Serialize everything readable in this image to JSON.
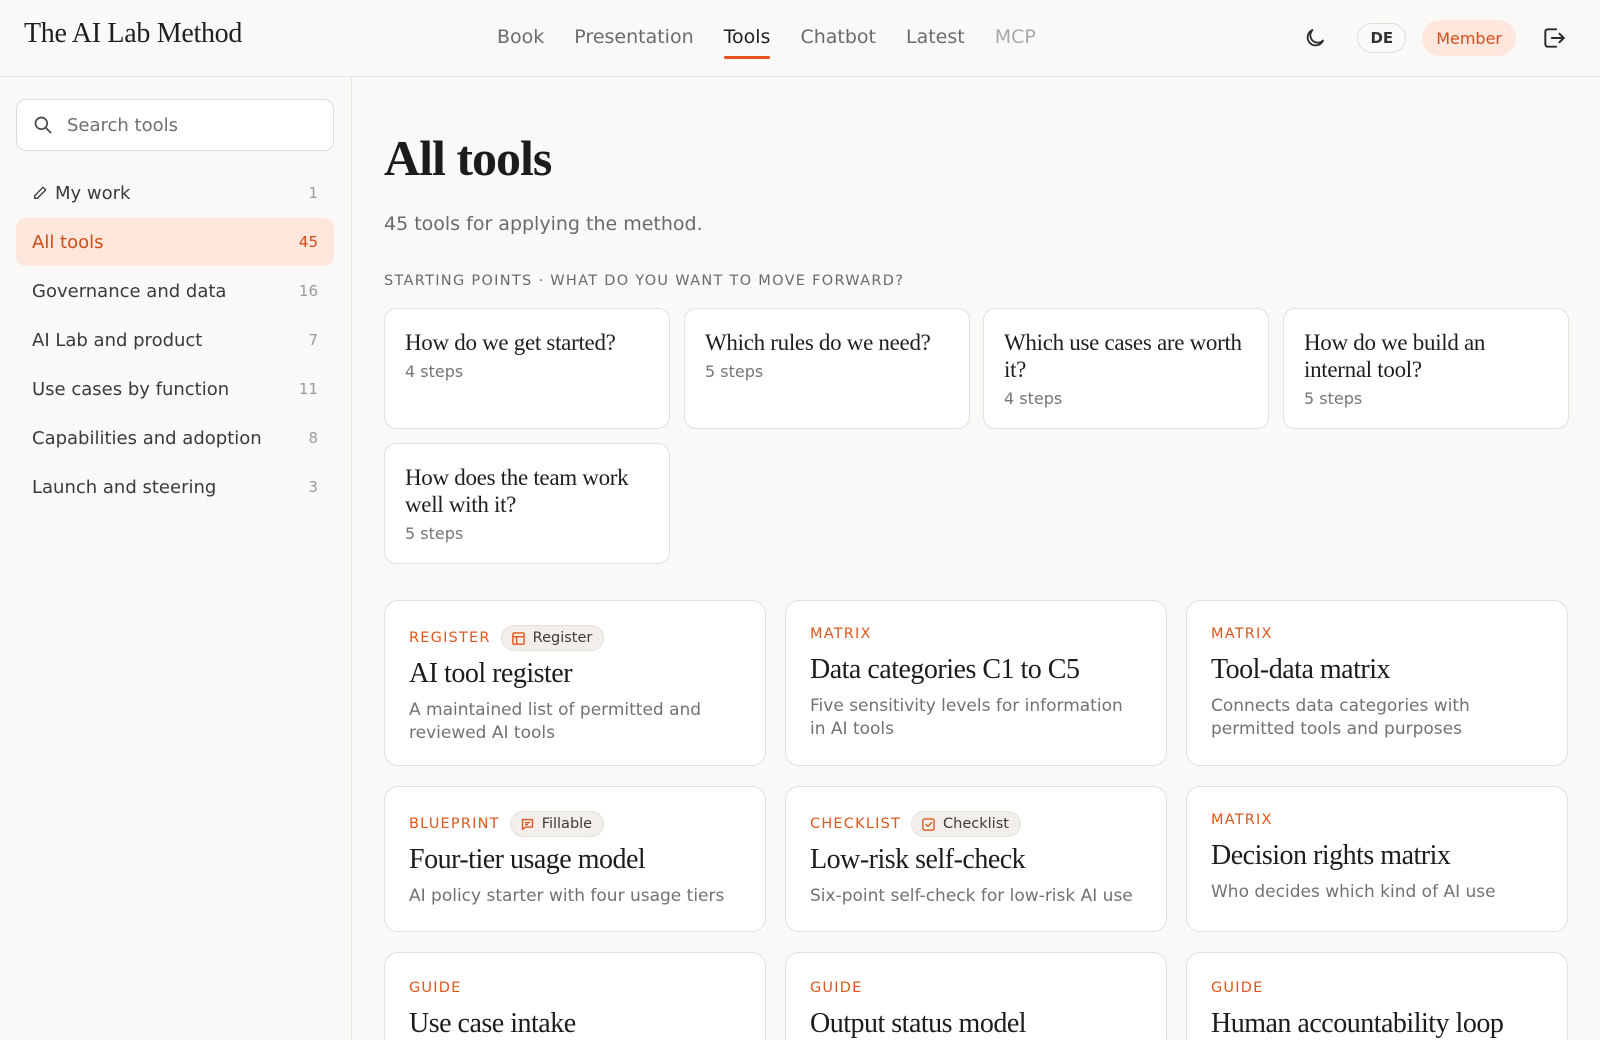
{
  "brand": "The AI Lab Method",
  "nav": [
    {
      "label": "Book",
      "state": "normal"
    },
    {
      "label": "Presentation",
      "state": "normal"
    },
    {
      "label": "Tools",
      "state": "active"
    },
    {
      "label": "Chatbot",
      "state": "normal"
    },
    {
      "label": "Latest",
      "state": "normal"
    },
    {
      "label": "MCP",
      "state": "muted"
    }
  ],
  "header": {
    "lang": "DE",
    "member": "Member",
    "icons": {
      "theme": "moon-icon",
      "logout": "logout-icon"
    }
  },
  "sidebar": {
    "search_placeholder": "Search tools",
    "items": [
      {
        "label": "My work",
        "count": "1",
        "icon": "pencil-icon"
      },
      {
        "label": "All tools",
        "count": "45",
        "active": true
      },
      {
        "label": "Governance and data",
        "count": "16"
      },
      {
        "label": "AI Lab and product",
        "count": "7"
      },
      {
        "label": "Use cases by function",
        "count": "11"
      },
      {
        "label": "Capabilities and adoption",
        "count": "8"
      },
      {
        "label": "Launch and steering",
        "count": "3"
      }
    ]
  },
  "main": {
    "title": "All tools",
    "subtitle": "45 tools for applying the method.",
    "section_label": "STARTING POINTS · WHAT DO YOU WANT TO MOVE FORWARD?",
    "starting_points": [
      {
        "question": "How do we get started?",
        "steps": "4 steps"
      },
      {
        "question": "Which rules do we need?",
        "steps": "5 steps"
      },
      {
        "question": "Which use cases are worth it?",
        "steps": "4 steps"
      },
      {
        "question": "How do we build an internal tool?",
        "steps": "5 steps"
      },
      {
        "question": "How does the team work well with it?",
        "steps": "5 steps"
      }
    ],
    "tools": [
      {
        "kind": "REGISTER",
        "tag": "Register",
        "tag_icon": "table-icon",
        "title": "AI tool register",
        "desc": "A maintained list of permitted and reviewed AI tools"
      },
      {
        "kind": "MATRIX",
        "title": "Data categories C1 to C5",
        "desc": "Five sensitivity levels for information in AI tools"
      },
      {
        "kind": "MATRIX",
        "title": "Tool-data matrix",
        "desc": "Connects data categories with permitted tools and purposes"
      },
      {
        "kind": "BLUEPRINT",
        "tag": "Fillable",
        "tag_icon": "comment-icon",
        "title": "Four-tier usage model",
        "desc": "AI policy starter with four usage tiers"
      },
      {
        "kind": "CHECKLIST",
        "tag": "Checklist",
        "tag_icon": "checkbox-icon",
        "title": "Low-risk self-check",
        "desc": "Six-point self-check for low-risk AI use"
      },
      {
        "kind": "MATRIX",
        "title": "Decision rights matrix",
        "desc": "Who decides which kind of AI use"
      },
      {
        "kind": "GUIDE",
        "title": "Use case intake",
        "desc": ""
      },
      {
        "kind": "GUIDE",
        "title": "Output status model",
        "desc": ""
      },
      {
        "kind": "GUIDE",
        "title": "Human accountability loop",
        "desc": ""
      }
    ]
  },
  "colors": {
    "accent": "#e4531a",
    "accent_bg": "#fde6dc",
    "page_bg": "#faf9f7"
  }
}
